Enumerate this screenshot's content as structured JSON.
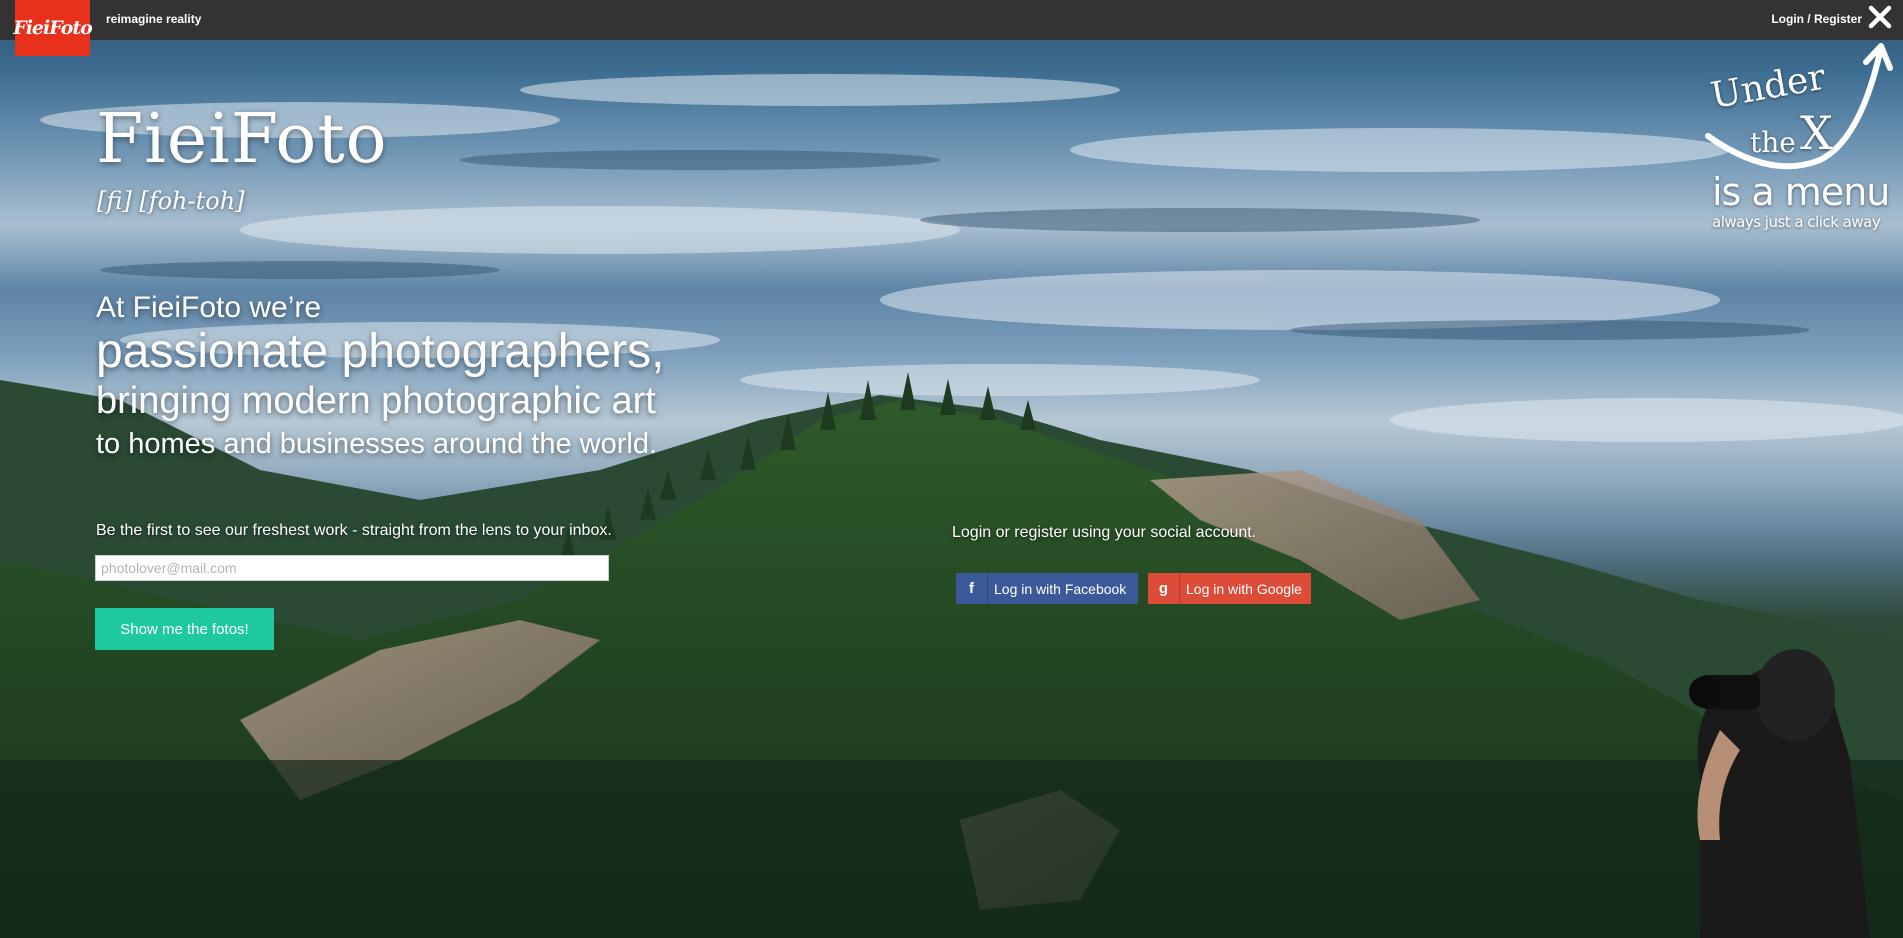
{
  "header": {
    "logo_text": "FieiFoto",
    "tagline": "reimagine reality",
    "login_link": "Login / Register",
    "close_icon": "close-x-icon"
  },
  "hero": {
    "title": "FieiFoto",
    "pronunciation": "[fi] [foh-toh]",
    "pitch": {
      "line1": "At FieiFoto we’re",
      "line2": "passionate photographers,",
      "line3": "bringing modern photographic art",
      "line4": "to homes and businesses around the world."
    }
  },
  "signup": {
    "text": "Be the first to see our freshest work - straight from the lens to your inbox.",
    "email_placeholder": "photolover@mail.com",
    "email_value": "",
    "button_label": "Show me the fotos!"
  },
  "social": {
    "text": "Login or register using your social account.",
    "facebook": {
      "icon": "f",
      "label": "Log in with Facebook",
      "color": "#3b5998"
    },
    "google": {
      "icon": "g",
      "label": "Log in with Google",
      "color": "#dd4b39"
    }
  },
  "menu_hint": {
    "under": "Under",
    "the": "the",
    "x": "X",
    "is_a_menu": "is a menu",
    "always": "always just a click away"
  },
  "colors": {
    "topbar": "#333333",
    "logo_bg": "#e8311b",
    "cta": "#1fc9a0"
  }
}
